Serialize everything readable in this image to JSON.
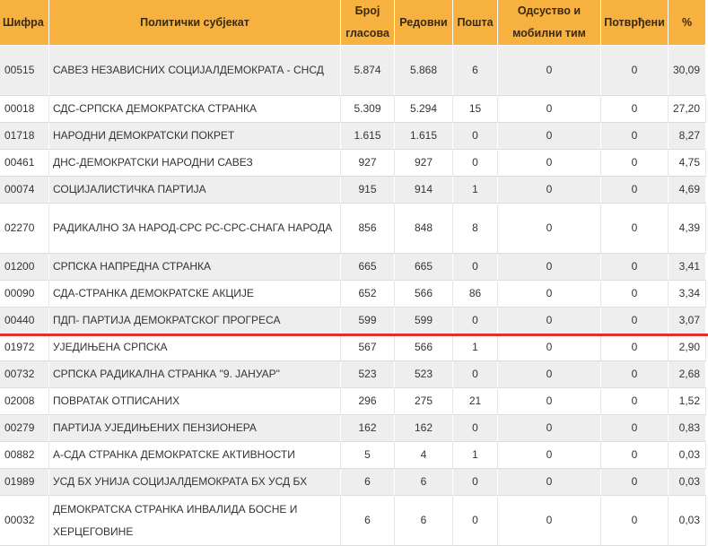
{
  "headers": {
    "code": "Шифра",
    "subject": "Политички субјекат",
    "votes": "Број гласова",
    "regular": "Редовни",
    "mail": "Пошта",
    "absent": "Одсуство и мобилни тим",
    "confirmed": "Потврђени",
    "percent": "%"
  },
  "rows": [
    {
      "code": "00515",
      "name": "САВЕЗ НЕЗАВИСНИХ СОЦИЈАЛДЕМОКРАТА - СНСД",
      "votes": "5.874",
      "regular": "5.868",
      "mail": "6",
      "absent": "0",
      "confirmed": "0",
      "percent": "30,09"
    },
    {
      "code": "00018",
      "name": "СДС-СРПСКА ДЕМОКРАТСКА СТРАНКА",
      "votes": "5.309",
      "regular": "5.294",
      "mail": "15",
      "absent": "0",
      "confirmed": "0",
      "percent": "27,20"
    },
    {
      "code": "01718",
      "name": "НАРОДНИ ДЕМОКРАТСКИ ПОКРЕТ",
      "votes": "1.615",
      "regular": "1.615",
      "mail": "0",
      "absent": "0",
      "confirmed": "0",
      "percent": "8,27"
    },
    {
      "code": "00461",
      "name": "ДНС-ДЕМОКРАТСКИ НАРОДНИ САВЕЗ",
      "votes": "927",
      "regular": "927",
      "mail": "0",
      "absent": "0",
      "confirmed": "0",
      "percent": "4,75"
    },
    {
      "code": "00074",
      "name": "СОЦИЈАЛИСТИЧКА ПАРТИЈА",
      "votes": "915",
      "regular": "914",
      "mail": "1",
      "absent": "0",
      "confirmed": "0",
      "percent": "4,69"
    },
    {
      "code": "02270",
      "name": "РАДИКАЛНО ЗА НАРОД-СРС РС-СРС-СНАГА НАРОДА",
      "votes": "856",
      "regular": "848",
      "mail": "8",
      "absent": "0",
      "confirmed": "0",
      "percent": "4,39"
    },
    {
      "code": "01200",
      "name": "СРПСКА НАПРЕДНА СТРАНКА",
      "votes": "665",
      "regular": "665",
      "mail": "0",
      "absent": "0",
      "confirmed": "0",
      "percent": "3,41"
    },
    {
      "code": "00090",
      "name": "СДА-СТРАНКА ДЕМОКРАТСКЕ АКЦИЈЕ",
      "votes": "652",
      "regular": "566",
      "mail": "86",
      "absent": "0",
      "confirmed": "0",
      "percent": "3,34"
    },
    {
      "code": "00440",
      "name": "ПДП- ПАРТИЈА ДЕМОКРАТСКОГ ПРОГРЕСА",
      "votes": "599",
      "regular": "599",
      "mail": "0",
      "absent": "0",
      "confirmed": "0",
      "percent": "3,07"
    },
    {
      "code": "01972",
      "name": "УЈЕДИЊЕНА СРПСКА",
      "votes": "567",
      "regular": "566",
      "mail": "1",
      "absent": "0",
      "confirmed": "0",
      "percent": "2,90"
    },
    {
      "code": "00732",
      "name": "СРПСКА РАДИКАЛНА СТРАНКА \"9. ЈАНУАР\"",
      "votes": "523",
      "regular": "523",
      "mail": "0",
      "absent": "0",
      "confirmed": "0",
      "percent": "2,68"
    },
    {
      "code": "02008",
      "name": "ПОВРАТАК ОТПИСАНИХ",
      "votes": "296",
      "regular": "275",
      "mail": "21",
      "absent": "0",
      "confirmed": "0",
      "percent": "1,52"
    },
    {
      "code": "00279",
      "name": "ПАРТИЈА УЈЕДИЊЕНИХ ПЕНЗИОНЕРА",
      "votes": "162",
      "regular": "162",
      "mail": "0",
      "absent": "0",
      "confirmed": "0",
      "percent": "0,83"
    },
    {
      "code": "00882",
      "name": "А-СДА СТРАНКА ДЕМОКРАТСКЕ АКТИВНОСТИ",
      "votes": "5",
      "regular": "4",
      "mail": "1",
      "absent": "0",
      "confirmed": "0",
      "percent": "0,03"
    },
    {
      "code": "01989",
      "name": "УСД БХ УНИЈА СОЦИЈАЛДЕМОКРАТА БХ УСД БХ",
      "votes": "6",
      "regular": "6",
      "mail": "0",
      "absent": "0",
      "confirmed": "0",
      "percent": "0,03"
    },
    {
      "code": "00032",
      "name": "ДЕМОКРАТСКА СТРАНКА ИНВАЛИДА БОСНЕ И ХЕРЦЕГОВИНЕ",
      "votes": "6",
      "regular": "6",
      "mail": "0",
      "absent": "0",
      "confirmed": "0",
      "percent": "0,03"
    }
  ],
  "colors": {
    "header_bg": "#f7b13e",
    "row_alt_bg": "#eeeeee",
    "cutoff_line": "#e03030"
  }
}
